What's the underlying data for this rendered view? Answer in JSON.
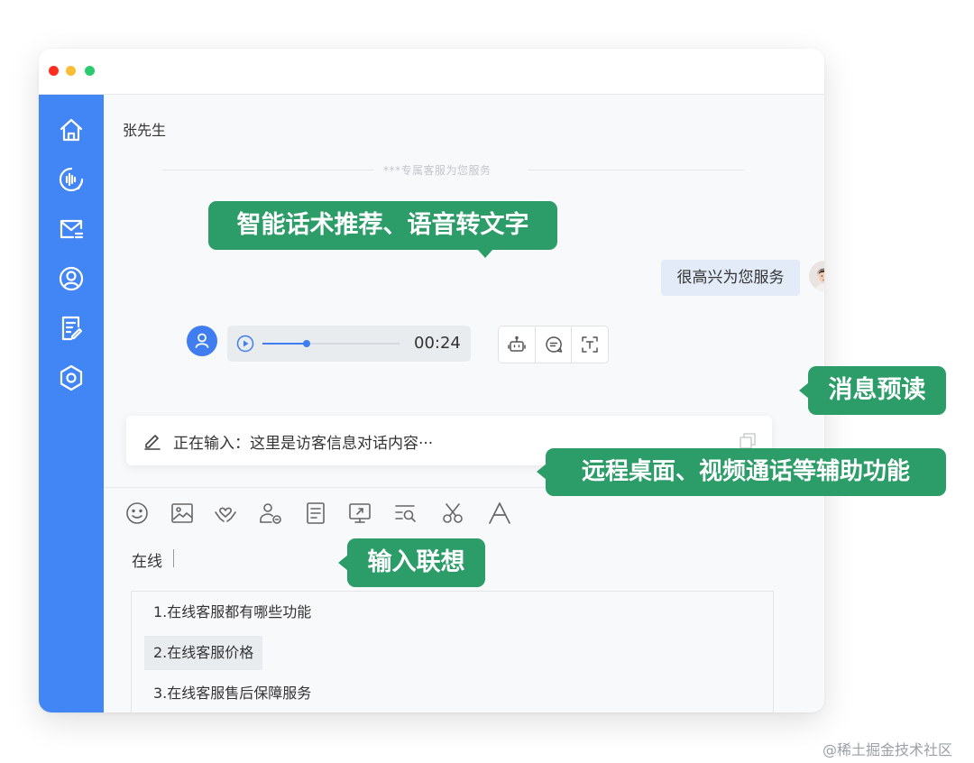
{
  "window": {
    "controls": [
      "close",
      "minimize",
      "zoom"
    ]
  },
  "sidebar": {
    "items": [
      {
        "icon": "home-icon"
      },
      {
        "icon": "voice-call-icon"
      },
      {
        "icon": "mail-icon"
      },
      {
        "icon": "user-profile-icon"
      },
      {
        "icon": "form-edit-icon"
      },
      {
        "icon": "settings-icon"
      }
    ],
    "color": "#4285f4"
  },
  "chat": {
    "contact_name": "张先生",
    "divider_text": "***专属客服为您服务",
    "agent_message": "很高兴为您服务",
    "voice_message": {
      "duration": "00:24",
      "progress": 0.32
    },
    "message_tools": [
      "robot-icon",
      "comment-icon",
      "text-recognize-icon"
    ]
  },
  "preview": {
    "text": "正在输入：这里是访客信息对话内容···"
  },
  "compose": {
    "toolbar": [
      "emoji-icon",
      "image-icon",
      "heart-hands-icon",
      "user-transfer-icon",
      "document-icon",
      "remote-desktop-icon",
      "search-list-icon",
      "scissors-icon",
      "font-icon"
    ],
    "input_value": "在线",
    "suggestions": [
      {
        "label": "1.在线客服都有哪些功能",
        "selected": false
      },
      {
        "label": "2.在线客服价格",
        "selected": true
      },
      {
        "label": "3.在线客服售后保障服务",
        "selected": false
      }
    ]
  },
  "callouts": {
    "smart_script": "智能话术推荐、语音转文字",
    "message_preview": "消息预读",
    "assist_features": "远程桌面、视频通话等辅助功能",
    "input_suggest": "输入联想",
    "color": "#2c9d68"
  },
  "watermark": "@稀土掘金技术社区"
}
